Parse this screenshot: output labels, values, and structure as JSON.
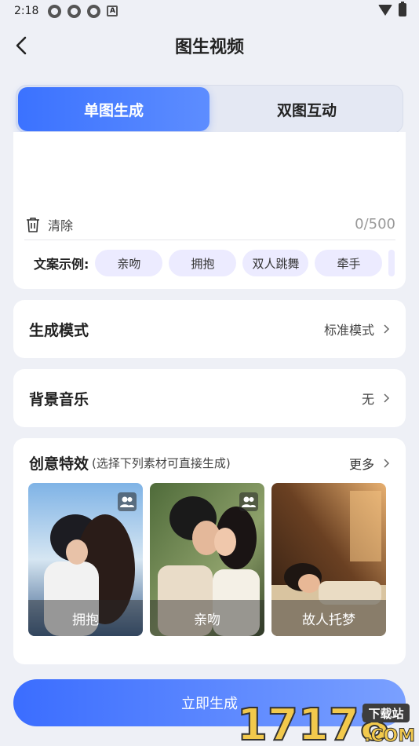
{
  "status_bar": {
    "time": "2:18",
    "app_icon_letter": "A"
  },
  "nav": {
    "title": "图生视频"
  },
  "tabs": [
    {
      "label": "单图生成",
      "active": true
    },
    {
      "label": "双图互动",
      "active": false
    }
  ],
  "text_area": {
    "clear_label": "清除",
    "char_count": "0/500",
    "examples_label": "文案示例:",
    "examples": [
      "亲吻",
      "拥抱",
      "双人跳舞",
      "牵手"
    ]
  },
  "settings": {
    "mode": {
      "title": "生成模式",
      "value": "标准模式"
    },
    "music": {
      "title": "背景音乐",
      "value": "无"
    }
  },
  "creative": {
    "title": "创意特效",
    "subtitle": "(选择下列素材可直接生成)",
    "more_label": "更多",
    "items": [
      {
        "caption": "拥抱",
        "two_person": true
      },
      {
        "caption": "亲吻",
        "two_person": true
      },
      {
        "caption": "故人托梦",
        "two_person": false
      }
    ]
  },
  "generate_label": "立即生成",
  "watermark": {
    "number": "17178",
    "tag": "下载站",
    "domain": ".COM"
  },
  "colors": {
    "accent": "#3b72ff",
    "chip_bg": "#ecebff",
    "page_bg": "#eef0f6"
  }
}
